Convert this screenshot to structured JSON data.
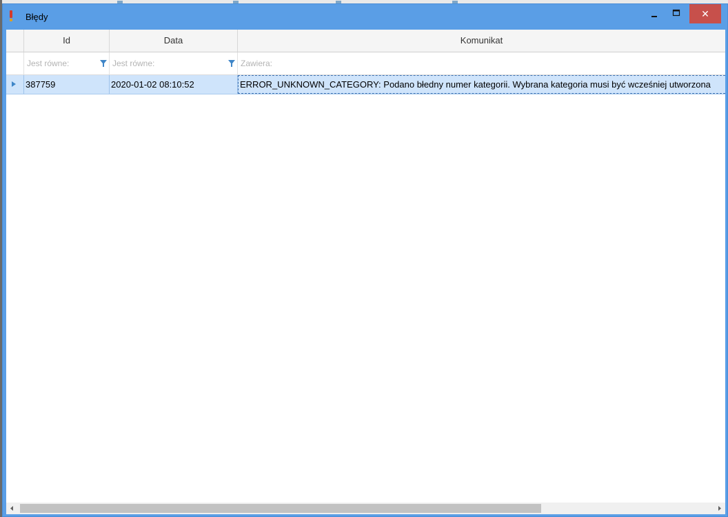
{
  "window": {
    "title": "Błędy",
    "accent_color": "#5a9ee6",
    "close_color": "#c7504b"
  },
  "controls": {
    "minimize_icon": "minimize-icon",
    "maximize_icon": "maximize-icon",
    "close_icon": "close-icon",
    "close_glyph": "✕"
  },
  "grid": {
    "columns": [
      "Id",
      "Data",
      "Komunikat"
    ],
    "filters": [
      {
        "placeholder": "Jest równe:",
        "value": ""
      },
      {
        "placeholder": "Jest równe:",
        "value": ""
      },
      {
        "placeholder": "Zawiera:",
        "value": ""
      }
    ],
    "rows": [
      {
        "id": "387759",
        "data": "2020-01-02 08:10:52",
        "komunikat": "ERROR_UNKNOWN_CATEGORY: Podano błedny numer kategorii. Wybrana kategoria musi być wcześniej utworzona"
      }
    ],
    "selected_row_color": "#cfe4fb"
  }
}
